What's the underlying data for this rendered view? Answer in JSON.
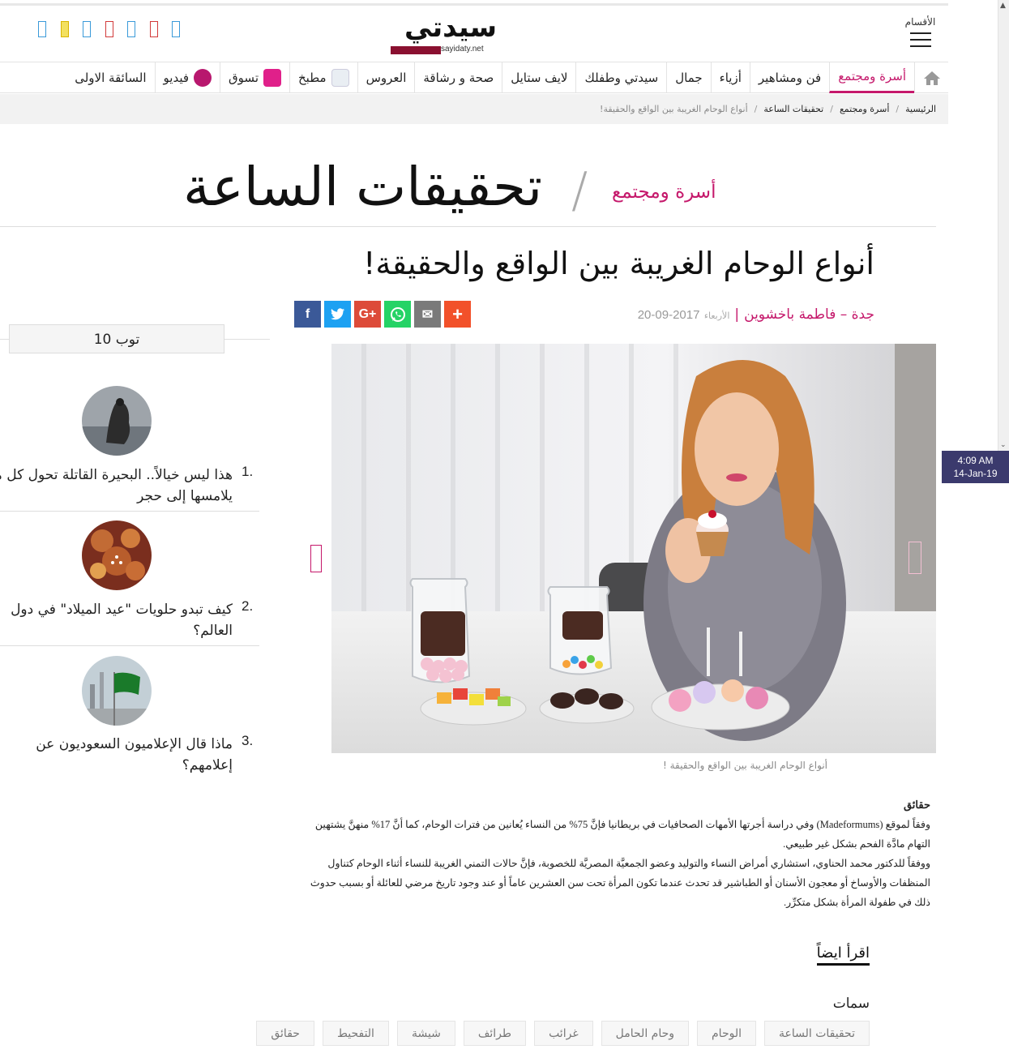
{
  "header": {
    "menu_label": "الأقسام",
    "logo_text": "سيدتي",
    "logo_domain": "sayidaty.net",
    "channels": [
      {
        "color": "#3a9ad9"
      },
      {
        "color": "#d9b400"
      },
      {
        "color": "#3a9ad9"
      },
      {
        "color": "#d23a3a"
      },
      {
        "color": "#3a9ad9"
      },
      {
        "color": "#d23a3a"
      },
      {
        "color": "#3a9ad9"
      }
    ]
  },
  "nav": {
    "items": [
      {
        "label": "أسرة ومجتمع",
        "active": true
      },
      {
        "label": "فن ومشاهير"
      },
      {
        "label": "أزياء"
      },
      {
        "label": "جمال"
      },
      {
        "label": "سيدتي وطفلك"
      },
      {
        "label": "لايف ستايل"
      },
      {
        "label": "صحة و رشاقة"
      },
      {
        "label": "العروس"
      },
      {
        "label": "مطبخ"
      },
      {
        "label": "تسوق"
      },
      {
        "label": "فيديو"
      },
      {
        "label": "السائقة الاولى"
      }
    ]
  },
  "breadcrumb": {
    "items": [
      "الرئيسية",
      "أسرة ومجتمع",
      "تحقيقات الساعة"
    ],
    "current": "أنواع الوحام الغريبة بين الواقع والحقيقة!"
  },
  "section": {
    "category": "أسرة ومجتمع",
    "title": "تحقيقات الساعة"
  },
  "article": {
    "title": "أنواع الوحام الغريبة بين الواقع والحقيقة!",
    "author": "جدة – فاطمة باخشوين",
    "day": "الأربعاء",
    "date": "2017-09-20",
    "caption": "أنواع الوحام الغريبة بين الواقع والحقيقة !",
    "heading": "حقائق",
    "paragraphs": [
      "وفقاً لموقع (Madeformums) وفي دراسة أجرتها الأمهات الصحافيات في بريطانيا فإنَّ 75% من النساء يُعانين من فترات الوحام، كما أنَّ 17% منهنَّ يشتهين التهام مادَّة الفحم بشكل غير طبيعي.",
      "ووفقاً للدكتور محمد الحناوي، استشاري أمراض النساء والتوليد وعضو الجمعيَّة المصريَّة للخصوبة، فإنَّ حالات التمني الغريبة للنساء أثناء الوحام كتناول المنظفات والأوساخ أو معجون الأسنان أو الطباشير قد تحدث عندما تكون المرأة تحت سن العشرين عاماً أو عند وجود تاريخ مرضي للعائلة أو بسبب حدوث ذلك في طفولة المرأة بشكل متكرِّر."
    ],
    "read_also": "اقرأ ايضاً",
    "tags_title": "سمات",
    "tags": [
      "تحقيقات الساعة",
      "الوحام",
      "وحام الحامل",
      "غرائب",
      "طرائف",
      "شيشة",
      "التفحيط",
      "حقائق"
    ]
  },
  "share": [
    {
      "name": "facebook",
      "glyph": "f",
      "color": "#3b5998"
    },
    {
      "name": "twitter",
      "glyph": "t",
      "color": "#1da1f2"
    },
    {
      "name": "google-plus",
      "glyph": "G+",
      "color": "#dd4b39"
    },
    {
      "name": "whatsapp",
      "glyph": "w",
      "color": "#25d366"
    },
    {
      "name": "email",
      "glyph": "✉",
      "color": "#7a7a7a"
    },
    {
      "name": "more",
      "glyph": "+",
      "color": "#f2512a"
    }
  ],
  "sidebar": {
    "title": "توب 10",
    "items": [
      {
        "num": "1.",
        "line1": "هذا ليس خيالاً.. البحيرة القاتلة تحول كل ما",
        "line2": "يلامسها إلى حجر"
      },
      {
        "num": "2.",
        "line1": "كيف تبدو حلويات \"عيد الميلاد\" في دول",
        "line2": "العالم؟"
      },
      {
        "num": "3.",
        "line1": "ماذا قال الإعلاميون السعوديون عن",
        "line2": "إعلامهم؟"
      }
    ]
  },
  "clock": {
    "time": "4:09 AM",
    "date": "14-Jan-19"
  }
}
